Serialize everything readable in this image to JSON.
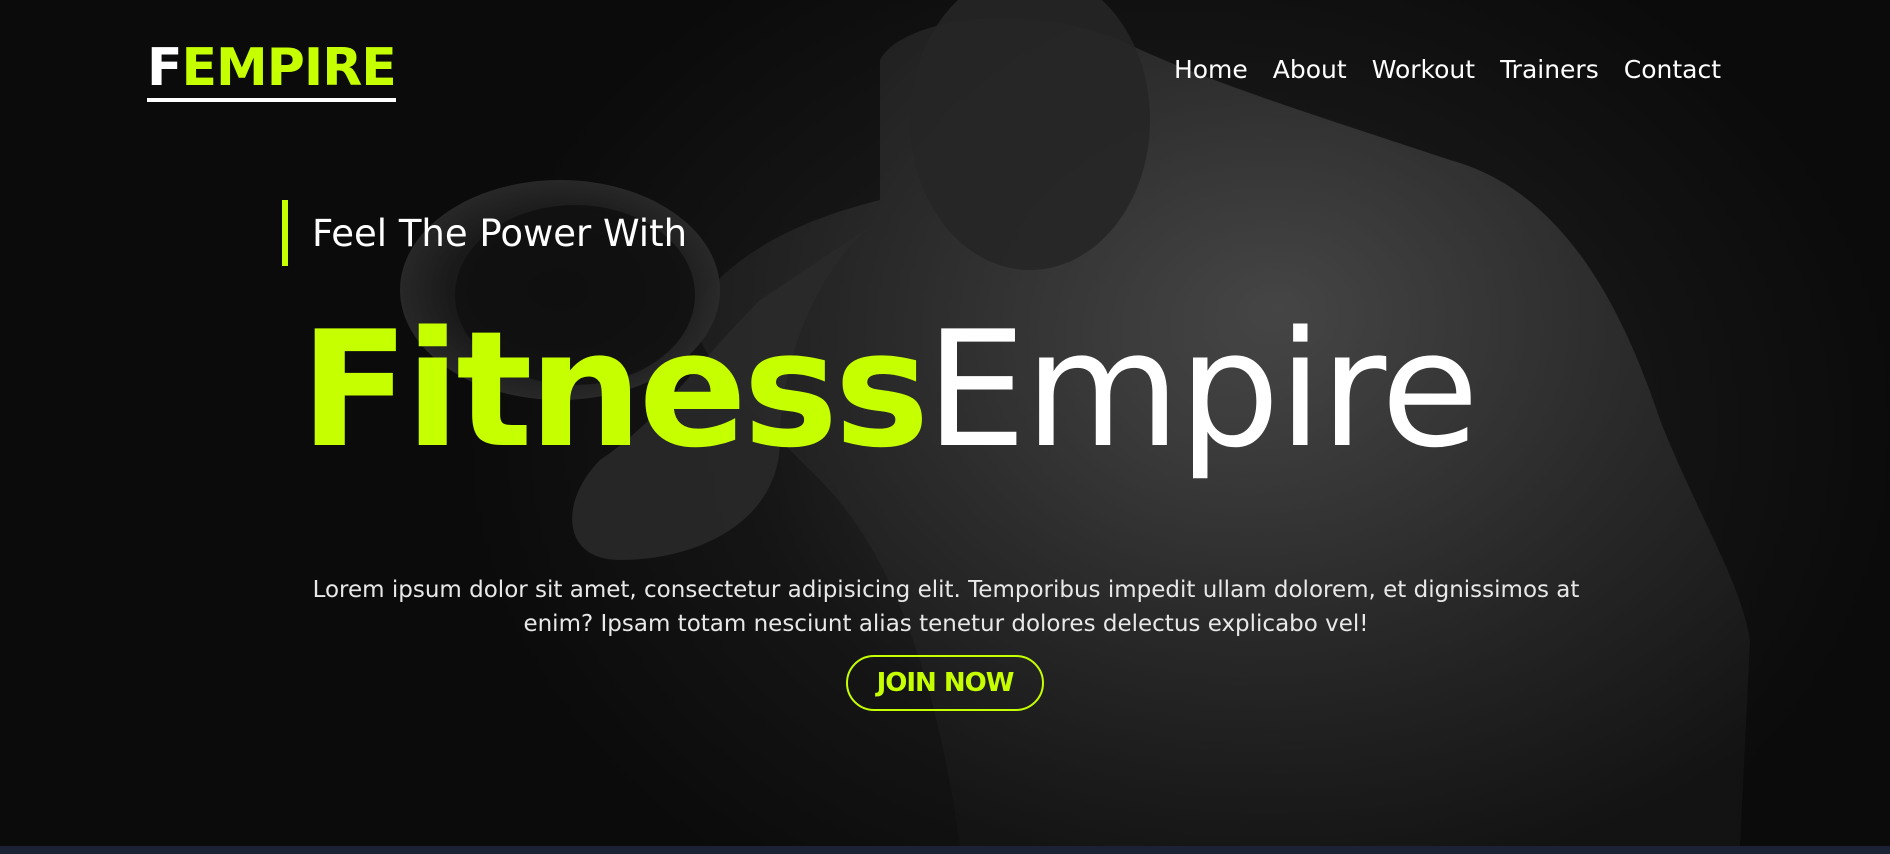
{
  "brand": {
    "logo_first": "F",
    "logo_rest": "EMPIRE",
    "accent_color": "#c5ff00"
  },
  "nav": {
    "items": [
      "Home",
      "About",
      "Workout",
      "Trainers",
      "Contact"
    ]
  },
  "hero": {
    "tagline": "Feel The Power With",
    "title_part1": "Fitness",
    "title_part2": "Empire",
    "description": "Lorem ipsum dolor sit amet, consectetur adipisicing elit. Temporibus impedit ullam dolorem, et dignissimos at enim? Ipsam totam nesciunt alias tenetur dolores delectus explicabo vel!",
    "cta_label": "JOIN NOW",
    "background_image": "bodybuilder-curling-dumbbell-photo"
  }
}
